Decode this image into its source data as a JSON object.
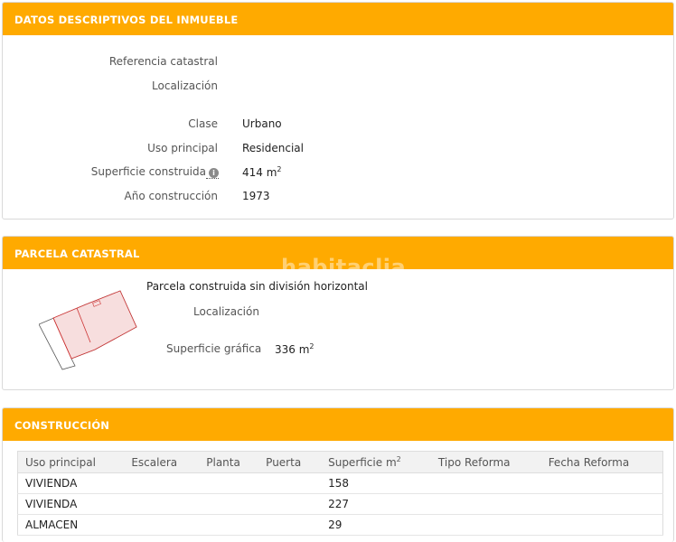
{
  "watermark": "habitaclia",
  "datos": {
    "title": "DATOS DESCRIPTIVOS DEL INMUEBLE",
    "rows": [
      {
        "label": "Referencia catastral",
        "value": ""
      },
      {
        "label": "Localización",
        "value": ""
      },
      {
        "label": "Clase",
        "value": "Urbano"
      },
      {
        "label": "Uso principal",
        "value": "Residencial"
      },
      {
        "label": "Superficie construida",
        "value": "414 m",
        "unit_sup": "2"
      },
      {
        "label": "Año construcción",
        "value": "1973"
      }
    ]
  },
  "parcela": {
    "title": "PARCELA CATASTRAL",
    "subtitle": "Parcela construida sin división horizontal",
    "localizacion_label": "Localización",
    "superficie_label": "Superficie gráfica",
    "superficie_value": "336 m",
    "superficie_sup": "2"
  },
  "construccion": {
    "title": "CONSTRUCCIÓN",
    "columns": [
      "Uso principal",
      "Escalera",
      "Planta",
      "Puerta",
      "Superficie m",
      "Tipo Reforma",
      "Fecha Reforma"
    ],
    "superficie_sup": "2",
    "rows": [
      [
        "VIVIENDA",
        "",
        "",
        "",
        "158",
        "",
        ""
      ],
      [
        "VIVIENDA",
        "",
        "",
        "",
        "227",
        "",
        ""
      ],
      [
        "ALMACEN",
        "",
        "",
        "",
        "29",
        "",
        ""
      ]
    ]
  }
}
